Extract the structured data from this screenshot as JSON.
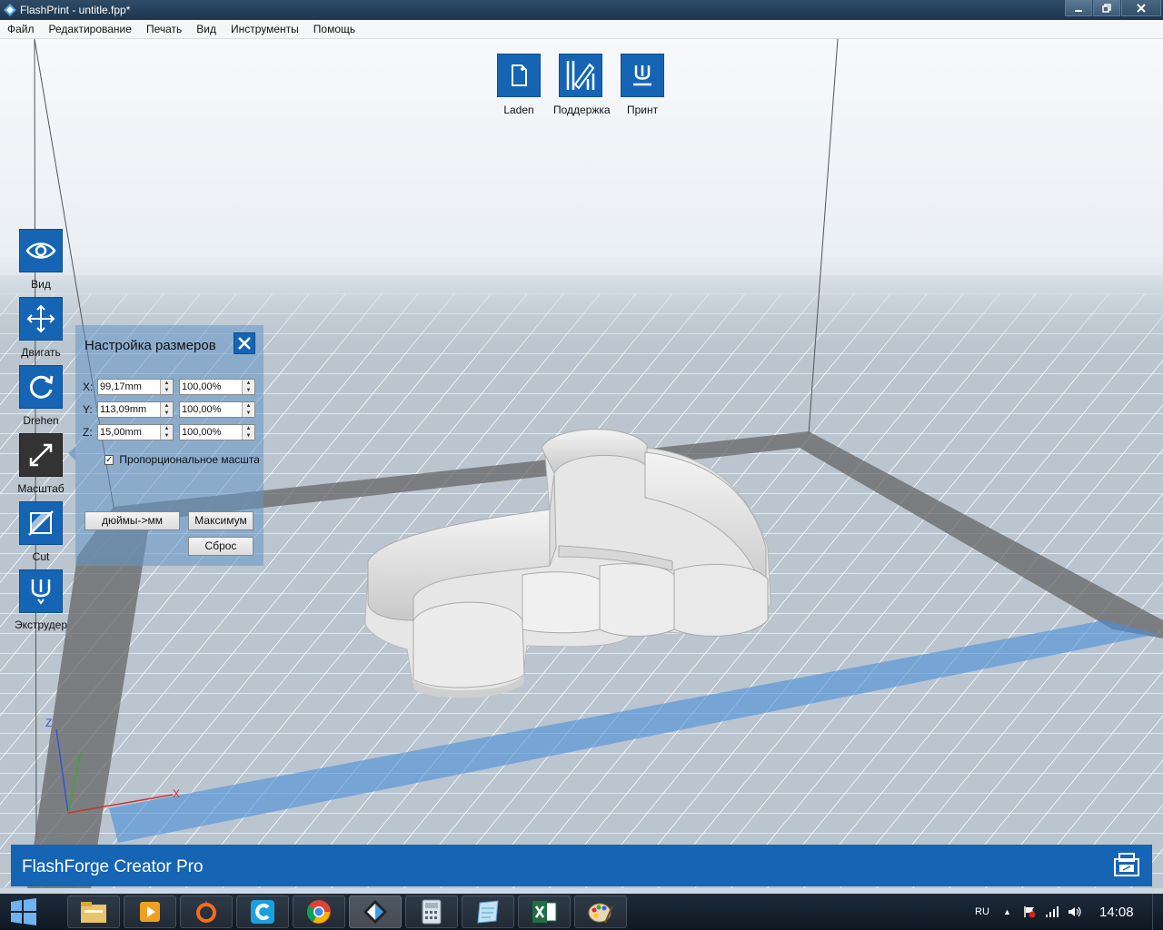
{
  "window": {
    "title": "FlashPrint - untitle.fpp*",
    "controls": [
      "minimize-icon",
      "restore-icon",
      "close-icon"
    ]
  },
  "menu": [
    "Файл",
    "Редактирование",
    "Печать",
    "Вид",
    "Инструменты",
    "Помощь"
  ],
  "top_toolbar": [
    {
      "label": "Laden",
      "icon": "load-file-icon"
    },
    {
      "label": "Поддержка",
      "icon": "support-icon"
    },
    {
      "label": "Принт",
      "icon": "print-icon"
    }
  ],
  "left_toolbar": [
    {
      "label": "Вид",
      "icon": "eye-icon",
      "active": false
    },
    {
      "label": "Двигать",
      "icon": "move-icon",
      "active": false
    },
    {
      "label": "Drehen",
      "icon": "rotate-icon",
      "active": false
    },
    {
      "label": "Масштаб",
      "icon": "scale-icon",
      "active": true
    },
    {
      "label": "Cut",
      "icon": "cut-icon",
      "active": false
    },
    {
      "label": "Экструдер",
      "icon": "extruder-icon",
      "active": false
    }
  ],
  "scale_panel": {
    "title": "Настройка размеров",
    "rows": [
      {
        "axis": "X:",
        "size": "99,17mm",
        "percent": "100,00%"
      },
      {
        "axis": "Y:",
        "size": "113,09mm",
        "percent": "100,00%"
      },
      {
        "axis": "Z:",
        "size": "15,00mm",
        "percent": "100,00%"
      }
    ],
    "proportional_label": "Пропорциональное масштабирование",
    "proportional_checked": true,
    "checkmark": "✓",
    "inch_to_mm_button": "дюймы->мм",
    "maximum_button": "Максимум",
    "reset_button": "Сброс"
  },
  "axis_labels": {
    "x": "X",
    "y": "Y",
    "z": "Z"
  },
  "printer": {
    "name": "FlashForge Creator Pro",
    "icon": "printer-icon"
  },
  "taskbar": {
    "apps": [
      "explorer-icon",
      "media-player-icon",
      "origin-icon",
      "ccleaner-icon",
      "chrome-icon",
      "flashprint-icon",
      "calculator-icon",
      "notes-icon",
      "excel-icon",
      "paint-icon"
    ],
    "language": "RU",
    "clock": "14:08"
  },
  "colors": {
    "accent": "#1565b4",
    "active_tool": "#333333",
    "title_bar": "#2f4b66"
  }
}
